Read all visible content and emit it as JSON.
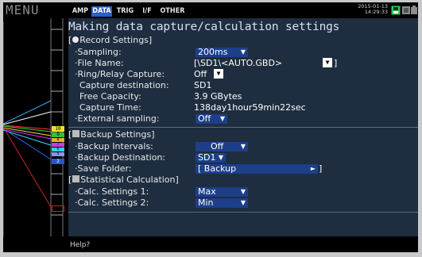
{
  "menu_label": "MENU",
  "tabs": [
    {
      "label": "AMP",
      "active": false
    },
    {
      "label": "DATA",
      "active": true
    },
    {
      "label": "TRIG",
      "active": false
    },
    {
      "label": "I/F",
      "active": false
    },
    {
      "label": "OTHER",
      "active": false
    }
  ],
  "datetime": {
    "date": "2015-01-13",
    "time": "14:29:33"
  },
  "status_icons": [
    "save-status-icon",
    "memory-status-icon",
    "power-status-icon"
  ],
  "panel": {
    "title": "Making data capture/calculation settings",
    "record": {
      "heading": "Record Settings]",
      "heading_prefix": "[",
      "icon": "record-dot-icon",
      "sampling_label": "·Sampling:",
      "sampling_value": "200ms",
      "file_name_label": "·File Name:",
      "file_name_value": "[\\SD1\\<AUTO.GBD>",
      "file_name_close": "]",
      "ring_label": "·Ring/Relay Capture:",
      "ring_value": "Off",
      "dest_label": "Capture destination:",
      "dest_value": "SD1",
      "free_label": "Free Capacity:",
      "free_value": "3.9 GBytes",
      "time_label": "Capture Time:",
      "time_value": "138day1hour59min22sec",
      "ext_label": "·External sampling:",
      "ext_value": "Off"
    },
    "backup": {
      "heading": "Backup Settings]",
      "heading_prefix": "[",
      "icon": "backup-icon",
      "intervals_label": "·Backup Intervals:",
      "intervals_value": "Off",
      "dest_label": "·Backup Destination:",
      "dest_value": "SD1",
      "folder_label": "·Save Folder:",
      "folder_value": "[ Backup",
      "folder_close": "]"
    },
    "stats": {
      "heading": "Statistical Calculation]",
      "heading_prefix": "[",
      "icon": "stats-icon",
      "calc1_label": "·Calc. Settings 1:",
      "calc1_value": "Max",
      "calc2_label": "·Calc. Settings 2:",
      "calc2_value": "Min"
    }
  },
  "channel_markers": [
    "10",
    "9",
    "8",
    "7",
    "6",
    "5",
    "2"
  ],
  "help_text": "Help?",
  "colors": {
    "panel_bg": "#1e2d3f",
    "dropdown_bg": "#1d3f8a",
    "active_tab": "#2f5fc4",
    "status_green": "#34c759"
  }
}
